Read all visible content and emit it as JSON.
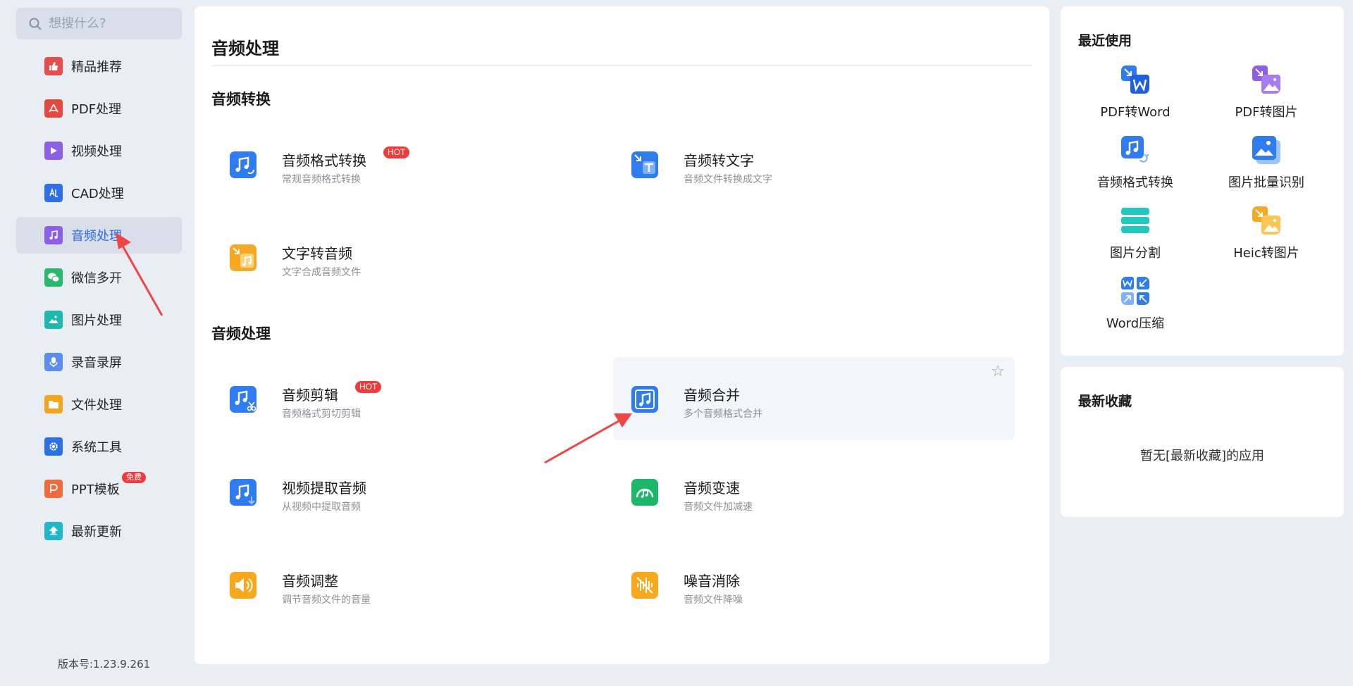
{
  "search": {
    "placeholder": "想搜什么?"
  },
  "sidebar": {
    "items": [
      {
        "label": "精品推荐",
        "color": "#ea4b4b"
      },
      {
        "label": "PDF处理",
        "color": "#e8473f"
      },
      {
        "label": "视频处理",
        "color": "#8d5ee6"
      },
      {
        "label": "CAD处理",
        "color": "#2d6fe8"
      },
      {
        "label": "音频处理",
        "color": "#8d5ee6"
      },
      {
        "label": "微信多开",
        "color": "#27ba6f"
      },
      {
        "label": "图片处理",
        "color": "#1fb8b0"
      },
      {
        "label": "录音录屏",
        "color": "#5b8def"
      },
      {
        "label": "文件处理",
        "color": "#f5a31a"
      },
      {
        "label": "系统工具",
        "color": "#2d6fe8"
      },
      {
        "label": "PPT模板",
        "color": "#f26a3a",
        "badge": "免费"
      },
      {
        "label": "最新更新",
        "color": "#20b8c8"
      }
    ],
    "version": "版本号:1.23.9.261"
  },
  "main": {
    "title": "音频处理",
    "sections": [
      {
        "title": "音频转换"
      },
      {
        "title": "音频处理"
      }
    ],
    "tools": [
      {
        "name": "音频格式转换",
        "desc": "常规音频格式转换",
        "badge": "HOT"
      },
      {
        "name": "音频转文字",
        "desc": "音频文件转换成文字"
      },
      {
        "name": "文字转音频",
        "desc": "文字合成音频文件"
      },
      {
        "name": "音频剪辑",
        "desc": "音频格式剪切剪辑",
        "badge": "HOT"
      },
      {
        "name": "音频合并",
        "desc": "多个音频格式合并"
      },
      {
        "name": "视频提取音频",
        "desc": "从视频中提取音频"
      },
      {
        "name": "音频变速",
        "desc": "音频文件加减速"
      },
      {
        "name": "音频调整",
        "desc": "调节音频文件的音量"
      },
      {
        "name": "噪音消除",
        "desc": "音频文件降噪"
      }
    ]
  },
  "recent": {
    "title": "最近使用",
    "items": [
      {
        "label": "PDF转Word"
      },
      {
        "label": "PDF转图片"
      },
      {
        "label": "音频格式转换"
      },
      {
        "label": "图片批量识别"
      },
      {
        "label": "图片分割"
      },
      {
        "label": "Heic转图片"
      },
      {
        "label": "Word压缩"
      }
    ]
  },
  "favorites": {
    "title": "最新收藏",
    "empty_text": "暂无[最新收藏]的应用"
  },
  "colors": {
    "accent": "#2e6bf0",
    "hot": "#ef3b3b",
    "arrow": "#f04545"
  }
}
